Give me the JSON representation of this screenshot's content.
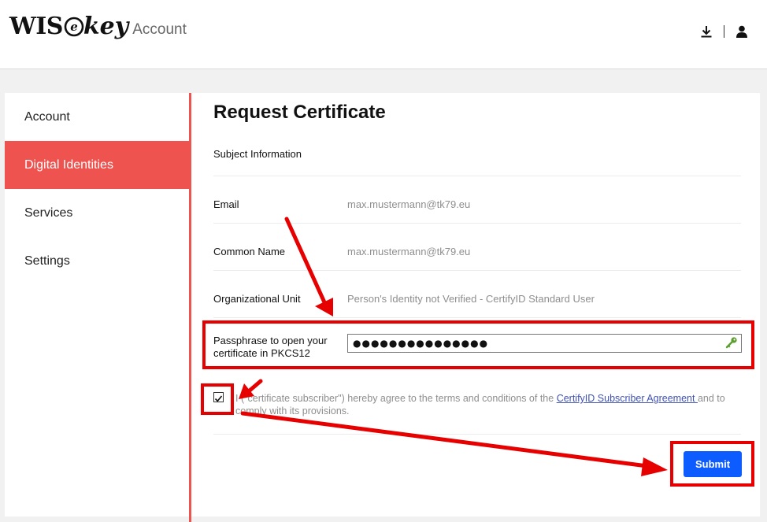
{
  "header": {
    "logo_wis": "WIS",
    "logo_e": "e",
    "logo_key": "key",
    "logo_sub": "Account"
  },
  "icons": {
    "download": "download-icon",
    "user": "user-icon",
    "key": "key-icon",
    "checkbox": "checkbox-icon"
  },
  "sidebar": {
    "items": [
      {
        "label": "Account",
        "active": false
      },
      {
        "label": "Digital Identities",
        "active": true
      },
      {
        "label": "Services",
        "active": false
      },
      {
        "label": "Settings",
        "active": false
      }
    ]
  },
  "form": {
    "title": "Request Certificate",
    "subject_heading": "Subject Information",
    "email_label": "Email",
    "email_value": "max.mustermann@tk79.eu",
    "cn_label": "Common Name",
    "cn_value": "max.mustermann@tk79.eu",
    "ou_label": "Organizational Unit",
    "ou_value": "Person's Identity not Verified - CertifyID Standard User",
    "passphrase_label": "Passphrase to open your certificate in PKCS12",
    "passphrase_value": "●●●●●●●●●●●●●●●",
    "agreement_prefix": "I (\"certificate subscriber\") hereby agree to the terms and conditions of the ",
    "agreement_link": "CertifyID Subscriber Agreement ",
    "agreement_suffix": "and to comply with its provisions.",
    "agreement_checked": true,
    "submit_label": "Submit"
  },
  "colors": {
    "accent": "#ef5350",
    "primary_button": "#0d5cff",
    "annotation": "#e60000",
    "key_icon": "#5a9e2e"
  }
}
